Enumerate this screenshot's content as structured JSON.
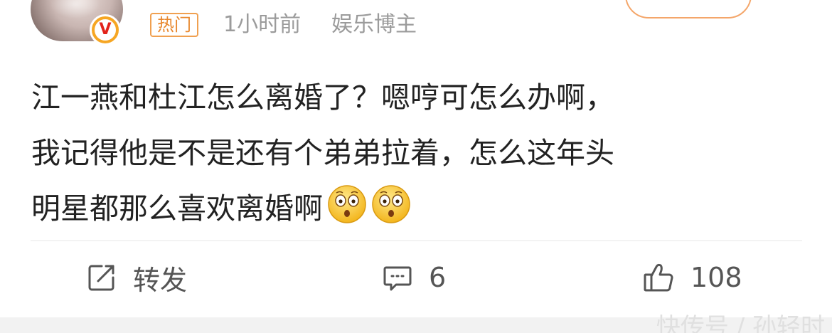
{
  "header": {
    "tag_label": "热门",
    "time": "1小时前",
    "role": "娱乐博主",
    "verified_badge": "V"
  },
  "content": {
    "lines": [
      "江一燕和杜江怎么离婚了？嗯哼可怎么办啊，",
      "我记得他是不是还有个弟弟拉着，怎么这年头",
      "明星都那么喜欢离婚啊"
    ],
    "emojis": [
      "shocked-face-icon",
      "shocked-face-icon"
    ]
  },
  "actions": {
    "repost_label": "转发",
    "comment_count": "6",
    "like_count": "108"
  },
  "watermark": "快传号 / 孙轻时",
  "colors": {
    "tag": "#e8872d",
    "meta": "#9b9b9b",
    "text": "#222222",
    "action": "#555555",
    "badge": "#f6a623"
  }
}
